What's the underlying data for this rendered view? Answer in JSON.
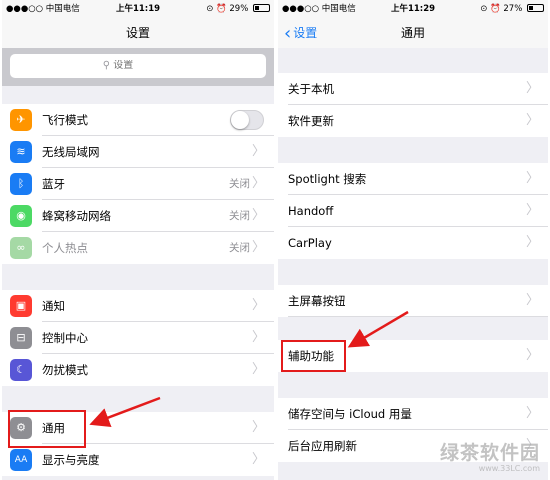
{
  "left": {
    "status": {
      "carrier": "●●●○○ 中国电信",
      "time": "上午11:19",
      "battery": "29%",
      "battery_level": 0.29
    },
    "nav_title": "设置",
    "search_placeholder": "设置",
    "rows": [
      {
        "label": "飞行模式",
        "icon": "airplane-icon",
        "icon_glyph": "✈",
        "color": "#ff9500",
        "toggle": true,
        "toggle_on": false
      },
      {
        "label": "无线局域网",
        "icon": "wifi-icon",
        "icon_glyph": "≋",
        "color": "#1a7cf4"
      },
      {
        "label": "蓝牙",
        "icon": "bluetooth-icon",
        "icon_glyph": "ᛒ",
        "color": "#1a7cf4",
        "value": "关闭"
      },
      {
        "label": "蜂窝移动网络",
        "icon": "cellular-icon",
        "icon_glyph": "◉",
        "color": "#4cd964",
        "value": "关闭"
      },
      {
        "label": "个人热点",
        "icon": "hotspot-icon",
        "icon_glyph": "∞",
        "color": "#a5d9a5",
        "value": "关闭",
        "dim": true
      },
      {
        "label": "通知",
        "icon": "notifications-icon",
        "icon_glyph": "▣",
        "color": "#ff3b30"
      },
      {
        "label": "控制中心",
        "icon": "control-center-icon",
        "icon_glyph": "⊟",
        "color": "#8e8e93"
      },
      {
        "label": "勿扰模式",
        "icon": "do-not-disturb-icon",
        "icon_glyph": "☾",
        "color": "#5856d6"
      },
      {
        "label": "通用",
        "icon": "gear-icon",
        "icon_glyph": "⚙",
        "color": "#8e8e93"
      },
      {
        "label": "显示与亮度",
        "icon": "display-brightness-icon",
        "icon_glyph": "AA",
        "color": "#1a7cf4"
      }
    ]
  },
  "right": {
    "status": {
      "carrier": "●●●○○ 中国电信",
      "time": "上午11:29",
      "battery": "27%",
      "battery_level": 0.27
    },
    "nav_title": "通用",
    "back_label": "设置",
    "rows": [
      {
        "label": "关于本机"
      },
      {
        "label": "软件更新"
      },
      {
        "label": "Spotlight 搜索"
      },
      {
        "label": "Handoff"
      },
      {
        "label": "CarPlay"
      },
      {
        "label": "主屏幕按钮"
      },
      {
        "label": "辅助功能"
      },
      {
        "label": "储存空间与 iCloud 用量"
      },
      {
        "label": "后台应用刷新"
      }
    ]
  },
  "watermark": {
    "main": "绿茶软件园",
    "sub": "www.33LC.com"
  },
  "colors": {
    "accent": "#1a7cf4",
    "annotation": "#e31b1b",
    "group_bg": "#efeff4"
  }
}
